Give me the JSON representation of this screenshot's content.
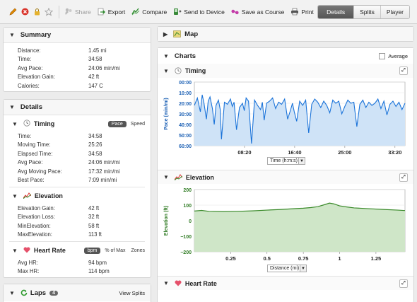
{
  "toolbar": {
    "share": "Share",
    "export": "Export",
    "compare": "Compare",
    "send": "Send to Device",
    "save_course": "Save as Course",
    "print": "Print",
    "views": [
      "Details",
      "Splits",
      "Player"
    ],
    "active_view": "Details"
  },
  "summary": {
    "title": "Summary",
    "rows": [
      {
        "label": "Distance:",
        "value": "1.45 mi"
      },
      {
        "label": "Time:",
        "value": "34:58"
      },
      {
        "label": "Avg Pace:",
        "value": "24:06 min/mi"
      },
      {
        "label": "Elevation Gain:",
        "value": "42 ft"
      },
      {
        "label": "Calories:",
        "value": "147 C"
      }
    ]
  },
  "details": {
    "title": "Details",
    "timing": {
      "title": "Timing",
      "toggle_active": "Pace",
      "toggle_other": "Speed",
      "rows": [
        {
          "label": "Time:",
          "value": "34:58"
        },
        {
          "label": "Moving Time:",
          "value": "25:26"
        },
        {
          "label": "Elapsed Time:",
          "value": "34:58"
        },
        {
          "label": "Avg Pace:",
          "value": "24:06 min/mi"
        },
        {
          "label": "Avg Moving Pace:",
          "value": "17:32 min/mi"
        },
        {
          "label": "Best Pace:",
          "value": "7:09 min/mi"
        }
      ]
    },
    "elevation": {
      "title": "Elevation",
      "rows": [
        {
          "label": "Elevation Gain:",
          "value": "42 ft"
        },
        {
          "label": "Elevation Loss:",
          "value": "32 ft"
        },
        {
          "label": "MinElevation:",
          "value": "58 ft"
        },
        {
          "label": "MaxElevation:",
          "value": "113 ft"
        }
      ]
    },
    "heart_rate": {
      "title": "Heart Rate",
      "toggle_active": "bpm",
      "toggle_pct": "% of Max",
      "toggle_zones": "Zones",
      "rows": [
        {
          "label": "Avg HR:",
          "value": "94 bpm"
        },
        {
          "label": "Max HR:",
          "value": "114 bpm"
        }
      ]
    }
  },
  "laps": {
    "title": "Laps",
    "count": "4",
    "view_splits": "View Splits"
  },
  "map": {
    "title": "Map"
  },
  "charts": {
    "title": "Charts",
    "average_label": "Average",
    "timing": {
      "title": "Timing",
      "axis_select": "Time (h:m:s)"
    },
    "elevation": {
      "title": "Elevation",
      "axis_select": "Distance (mi)"
    },
    "heart_rate": {
      "title": "Heart Rate"
    }
  },
  "chart_data": [
    {
      "type": "area",
      "title": "Timing",
      "ylabel": "Pace (min/mi)",
      "xlabel": "Time (h:m:s)",
      "y_ticks": [
        "00:00",
        "10:00",
        "20:00",
        "30:00",
        "40:00",
        "50:00",
        "60:00"
      ],
      "x_ticks": [
        "08:20",
        "16:40",
        "25:00",
        "33:20"
      ],
      "y_inverted": true,
      "ylim_minutes": [
        0,
        60
      ],
      "xlim_minutes": [
        0,
        35
      ],
      "color": "#1a73d9",
      "fill": "#cfe3f7",
      "series": [
        {
          "x": [
            0,
            0.5,
            1,
            1.3,
            1.6,
            2,
            2.3,
            2.6,
            3,
            3.3,
            3.6,
            4,
            4.3,
            4.5,
            5,
            5.5,
            6,
            6.3,
            6.6,
            7,
            7.5,
            8,
            8.3,
            8.6,
            9,
            9.5,
            10,
            10.5,
            11,
            11.3,
            11.6,
            12,
            12.5,
            13,
            13.5,
            14,
            14.5,
            15,
            15.5,
            16,
            16.3,
            16.6,
            17,
            17.5,
            18,
            18.5,
            19,
            19.5,
            20,
            20.5,
            21,
            21.5,
            22,
            22.5,
            23,
            23.5,
            24,
            24.5,
            25,
            25.5,
            26,
            26.5,
            27,
            27.5,
            28,
            28.5,
            29,
            29.5,
            30,
            30.5,
            31,
            31.5,
            32,
            32.5,
            33,
            33.5,
            34,
            34.5,
            35
          ],
          "y": [
            22,
            15,
            28,
            12,
            20,
            35,
            18,
            14,
            25,
            40,
            22,
            17,
            26,
            54,
            19,
            21,
            16,
            23,
            19,
            45,
            24,
            20,
            27,
            15,
            18,
            58,
            17,
            22,
            26,
            19,
            36,
            20,
            18,
            15,
            25,
            19,
            21,
            16,
            35,
            26,
            20,
            28,
            37,
            18,
            22,
            17,
            48,
            21,
            16,
            19,
            24,
            18,
            22,
            29,
            17,
            20,
            18,
            30,
            23,
            17,
            20,
            19,
            42,
            21,
            17,
            24,
            19,
            22,
            20,
            16,
            25,
            18,
            31,
            21,
            18,
            23,
            19,
            26,
            20
          ]
        }
      ]
    },
    {
      "type": "area",
      "title": "Elevation",
      "ylabel": "Elevation (ft)",
      "xlabel": "Distance (mi)",
      "y_ticks": [
        200,
        100,
        0,
        -100,
        -200
      ],
      "x_ticks": [
        0.25,
        0.5,
        0.75,
        1,
        1.25
      ],
      "ylim": [
        -200,
        200
      ],
      "xlim": [
        0,
        1.45
      ],
      "color": "#3a8a2a",
      "fill": "#cfe6c8",
      "series": [
        {
          "x": [
            0,
            0.05,
            0.1,
            0.2,
            0.3,
            0.4,
            0.5,
            0.6,
            0.7,
            0.75,
            0.8,
            0.85,
            0.9,
            0.93,
            0.96,
            1.0,
            1.05,
            1.1,
            1.2,
            1.3,
            1.4,
            1.45
          ],
          "y": [
            62,
            66,
            60,
            58,
            60,
            63,
            68,
            72,
            78,
            80,
            84,
            90,
            104,
            113,
            108,
            95,
            88,
            82,
            77,
            72,
            68,
            65
          ]
        }
      ]
    }
  ]
}
